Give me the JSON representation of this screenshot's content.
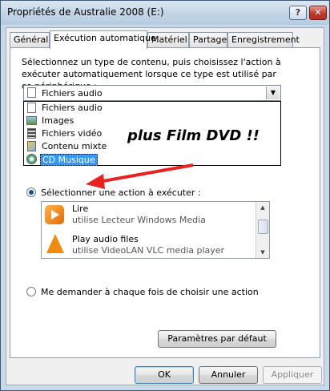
{
  "window": {
    "title": "Propriétés de Australie 2008 (E:)",
    "help_label": "?",
    "close_label": "✕"
  },
  "tabs": [
    {
      "label": "Général"
    },
    {
      "label": "Exécution automatique"
    },
    {
      "label": "Matériel"
    },
    {
      "label": "Partage"
    },
    {
      "label": "Enregistrement"
    }
  ],
  "instructions": "Sélectionnez un type de contenu, puis choisissez l'action à exécuter automatiquement lorsque ce type est utilisé par ce périphérique :",
  "content_type": {
    "selected": "Fichiers audio",
    "options": [
      {
        "label": "Fichiers audio",
        "icon": "audio-file-icon"
      },
      {
        "label": "Images",
        "icon": "image-file-icon"
      },
      {
        "label": "Fichiers vidéo",
        "icon": "video-file-icon"
      },
      {
        "label": "Contenu mixte",
        "icon": "mixed-content-icon"
      },
      {
        "label": "CD Musique",
        "icon": "music-cd-icon"
      }
    ],
    "highlighted": "CD Musique"
  },
  "annotation": "plus  Film DVD !!",
  "select_action_label": "Sélectionner une action à exécuter :",
  "actions": [
    {
      "name": "Lire",
      "sub": "utilise Lecteur Windows Media",
      "icon": "windows-media-player-icon"
    },
    {
      "name": "Play audio files",
      "sub": "utilise VideoLAN VLC media player",
      "icon": "vlc-cone-icon"
    }
  ],
  "ask_each_time_label": "Me demander à chaque fois de choisir une action",
  "buttons": {
    "defaults": "Paramètres par défaut",
    "ok": "OK",
    "cancel": "Annuler",
    "apply": "Appliquer"
  },
  "colors": {
    "title_bg": "#c2d5e5",
    "selection": "#3399ff",
    "arrow": "#e8231f"
  }
}
